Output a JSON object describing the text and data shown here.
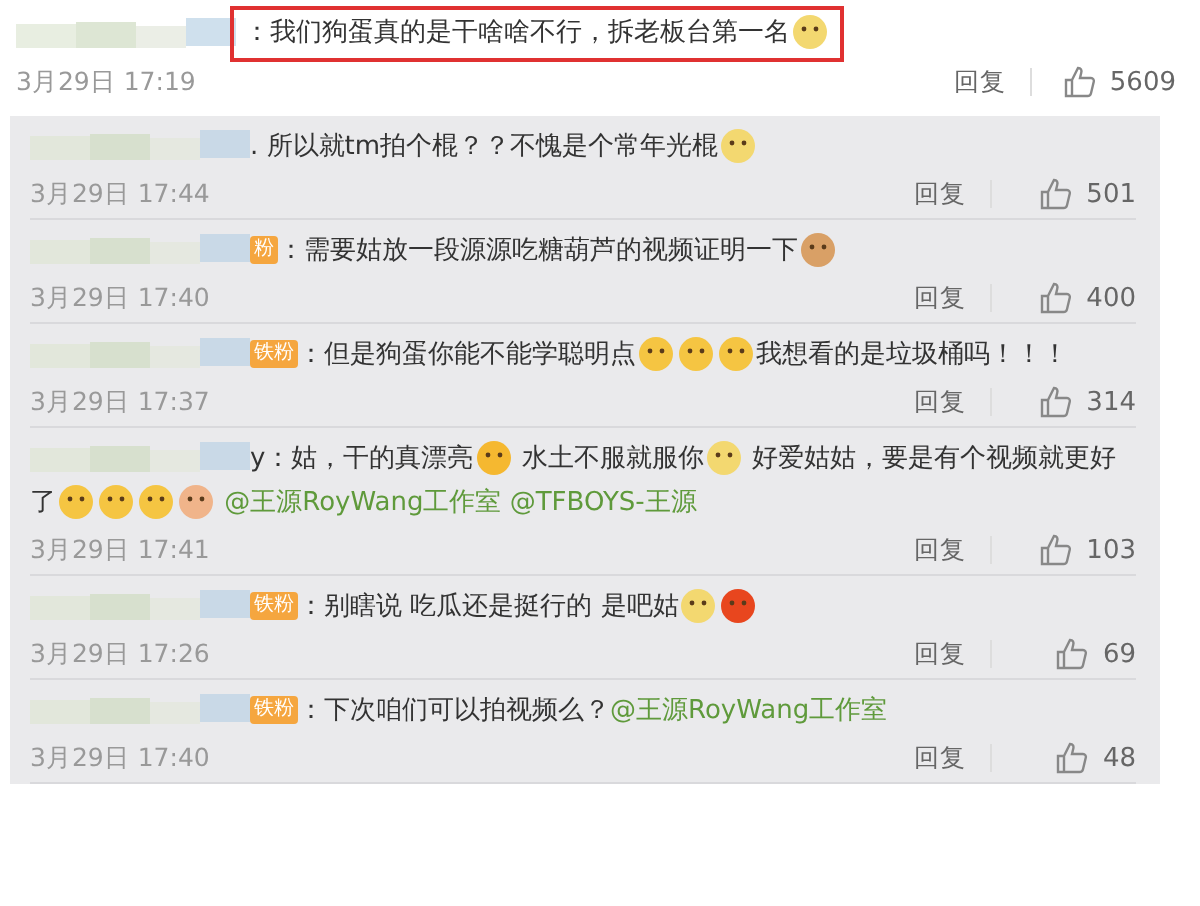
{
  "main_comment": {
    "highlighted": true,
    "segments": [
      {
        "kind": "text",
        "text": "：我们狗蛋真的是干啥啥不行，拆老板台第一名"
      },
      {
        "kind": "emoji",
        "color": "#f3d870"
      }
    ],
    "date": "3月29日 17:19",
    "reply": "回复",
    "likes": "5609"
  },
  "replies": [
    {
      "badge": false,
      "segments": [
        {
          "kind": "text",
          "text": ". 所以就tm拍个棍？？不愧是个常年光棍"
        },
        {
          "kind": "emoji",
          "color": "#f3d870"
        }
      ],
      "date": "3月29日 17:44",
      "reply": "回复",
      "likes": "501"
    },
    {
      "badge": true,
      "badge_text": "粉",
      "segments": [
        {
          "kind": "text",
          "text": "：需要姑放一段源源吃糖葫芦的视频证明一下"
        },
        {
          "kind": "emoji",
          "color": "#d9a066"
        }
      ],
      "date": "3月29日 17:40",
      "reply": "回复",
      "likes": "400"
    },
    {
      "badge": true,
      "badge_text": "铁粉",
      "segments": [
        {
          "kind": "text",
          "text": "：但是狗蛋你能不能学聪明点"
        },
        {
          "kind": "emoji",
          "color": "#f5c542"
        },
        {
          "kind": "emoji",
          "color": "#f5c542"
        },
        {
          "kind": "emoji",
          "color": "#f5c542"
        },
        {
          "kind": "text",
          "text": "我想看的是垃圾桶吗！！！"
        }
      ],
      "date": "3月29日 17:37",
      "reply": "回复",
      "likes": "314"
    },
    {
      "name_tail": "y",
      "badge": false,
      "segments": [
        {
          "kind": "text",
          "text": "：姑，干的真漂亮"
        },
        {
          "kind": "emoji",
          "color": "#f5b830"
        },
        {
          "kind": "text",
          "text": " 水土不服就服你"
        },
        {
          "kind": "emoji",
          "color": "#f3d870"
        },
        {
          "kind": "text",
          "text": " 好爱姑姑，要是有个视频就更好"
        },
        {
          "kind": "text",
          "text": "了"
        },
        {
          "kind": "emoji",
          "color": "#f5c542"
        },
        {
          "kind": "emoji",
          "color": "#f5c542"
        },
        {
          "kind": "emoji",
          "color": "#f5c542"
        },
        {
          "kind": "emoji",
          "color": "#f0b48a"
        },
        {
          "kind": "mention",
          "text": " @王源RoyWang工作室"
        },
        {
          "kind": "mention",
          "text": " @TFBOYS-王源"
        }
      ],
      "date": "3月29日 17:41",
      "reply": "回复",
      "likes": "103"
    },
    {
      "badge": true,
      "badge_text": "铁粉",
      "segments": [
        {
          "kind": "text",
          "text": "：别瞎说 吃瓜还是挺行的 是吧姑"
        },
        {
          "kind": "emoji",
          "color": "#f3d870"
        },
        {
          "kind": "emoji",
          "color": "#e8461e"
        }
      ],
      "date": "3月29日 17:26",
      "reply": "回复",
      "likes": "69"
    },
    {
      "badge": true,
      "badge_text": "铁粉",
      "segments": [
        {
          "kind": "text",
          "text": "：下次咱们可以拍视频么？"
        },
        {
          "kind": "mention",
          "text": "@王源RoyWang工作室"
        }
      ],
      "date": "3月29日 17:40",
      "reply": "回复",
      "likes": "48"
    }
  ]
}
